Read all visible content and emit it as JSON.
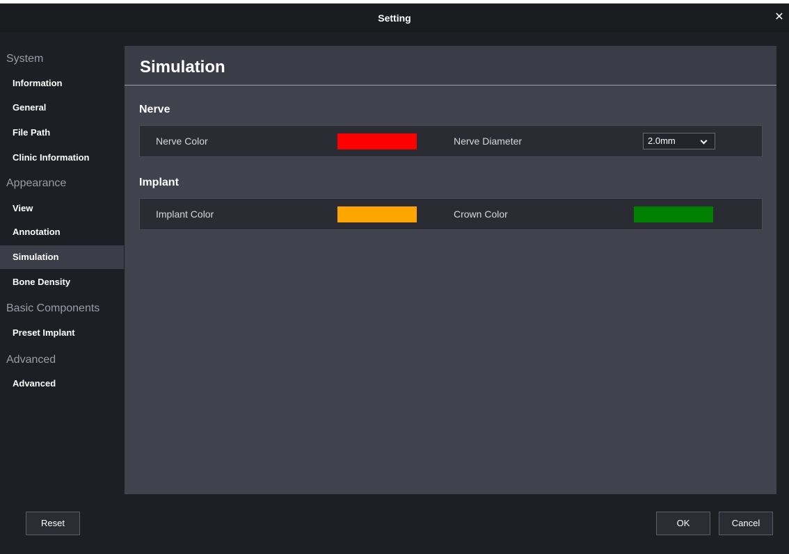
{
  "window": {
    "title": "Setting"
  },
  "sidebar": {
    "groups": [
      {
        "label": "System",
        "items": [
          "Information",
          "General",
          "File Path",
          "Clinic Information"
        ]
      },
      {
        "label": "Appearance",
        "items": [
          "View",
          "Annotation",
          "Simulation",
          "Bone Density"
        ]
      },
      {
        "label": "Basic Components",
        "items": [
          "Preset Implant"
        ]
      },
      {
        "label": "Advanced",
        "items": [
          "Advanced"
        ]
      }
    ],
    "active_item": "Simulation"
  },
  "main": {
    "title": "Simulation",
    "sections": [
      {
        "title": "Nerve",
        "nerve_color_label": "Nerve Color",
        "nerve_color": "#ff0000",
        "nerve_diameter_label": "Nerve Diameter",
        "nerve_diameter_value": "2.0mm"
      },
      {
        "title": "Implant",
        "implant_color_label": "Implant Color",
        "implant_color": "#ffa500",
        "crown_color_label": "Crown Color",
        "crown_color": "#008000"
      }
    ]
  },
  "footer": {
    "reset_label": "Reset",
    "ok_label": "OK",
    "cancel_label": "Cancel"
  },
  "icons": {
    "close": "close-icon",
    "dropdown": "chevron-down-icon"
  }
}
